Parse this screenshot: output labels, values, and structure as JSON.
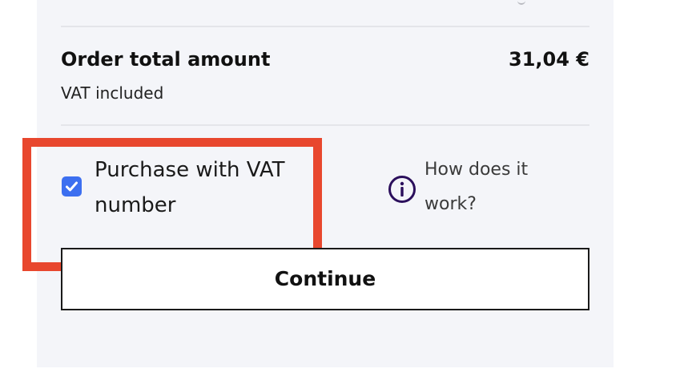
{
  "order": {
    "total_label": "Order total amount",
    "total_amount": "31,04 €",
    "vat_note": "VAT included"
  },
  "vat_option": {
    "checked": true,
    "label": "Purchase with VAT number",
    "icon": "checkmark-icon"
  },
  "help": {
    "icon": "info-icon",
    "link_text": "How does it work?"
  },
  "actions": {
    "continue_label": "Continue"
  },
  "colors": {
    "panel_bg": "#f4f5f9",
    "checkbox_accent": "#3c6ff0",
    "highlight": "#e8472e",
    "info_icon": "#2b0f5c"
  }
}
